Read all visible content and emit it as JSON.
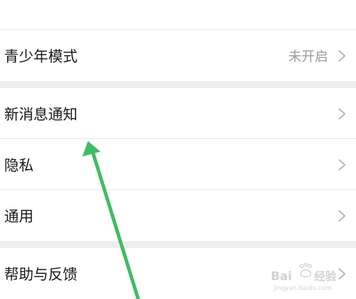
{
  "settings": {
    "top_row": {
      "label": ""
    },
    "youth_mode": {
      "label": "青少年模式",
      "value": "未开启"
    },
    "new_message_notifications": {
      "label": "新消息通知"
    },
    "privacy": {
      "label": "隐私"
    },
    "general": {
      "label": "通用"
    },
    "help_feedback": {
      "label": "帮助与反馈"
    }
  },
  "annotation": {
    "arrow_color": "#3dbd62"
  },
  "colors": {
    "page_background": "#ededed",
    "row_background": "#ffffff",
    "text_primary": "#1a1a1a",
    "text_secondary": "#9a9a9a",
    "chevron": "#b5b5b5"
  },
  "watermark": {
    "logo_text": "Bai 经验",
    "sub_text": "jingyan.baidu.com"
  }
}
